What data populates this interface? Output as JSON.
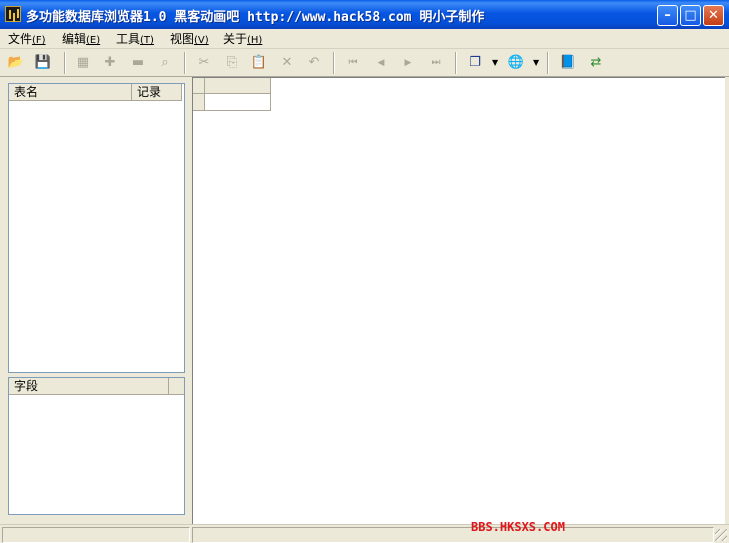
{
  "window": {
    "title": "多功能数据库浏览器1.0  黑客动画吧 http://www.hack58.com 明小子制作",
    "min_symbol": "–",
    "max_symbol": "□",
    "close_symbol": "✕"
  },
  "menu": [
    {
      "label": "文件",
      "mnemonic": "(F)"
    },
    {
      "label": "编辑",
      "mnemonic": "(E)"
    },
    {
      "label": "工具",
      "mnemonic": "(T)"
    },
    {
      "label": "视图",
      "mnemonic": "(V)"
    },
    {
      "label": "关于",
      "mnemonic": "(H)"
    }
  ],
  "toolbar": {
    "open_glyph": "📂",
    "save_glyph": "💾",
    "grid_glyph": "▦",
    "add_glyph": "✚",
    "window_glyph": "▬",
    "find_glyph": "⌕",
    "cut_glyph": "✂",
    "copy_glyph": "⎘",
    "paste_glyph": "📋",
    "delete_glyph": "✕",
    "undo_glyph": "↶",
    "first_glyph": "⏮",
    "prev_glyph": "◀",
    "next_glyph": "▶",
    "last_glyph": "⏭",
    "windows_glyph": "❐",
    "connect_glyph": "🌐",
    "book_glyph": "📘",
    "exit_glyph": "⇄",
    "dropdown_glyph": "▼"
  },
  "tables_panel": {
    "col_name": "表名",
    "col_records": "记录"
  },
  "fields_panel": {
    "col_field": "字段"
  },
  "status": {
    "watermark": "BBS.HKSXS.COM"
  },
  "colors": {
    "title_bar": "#0a5ee8",
    "watermark": "#e0161b"
  }
}
